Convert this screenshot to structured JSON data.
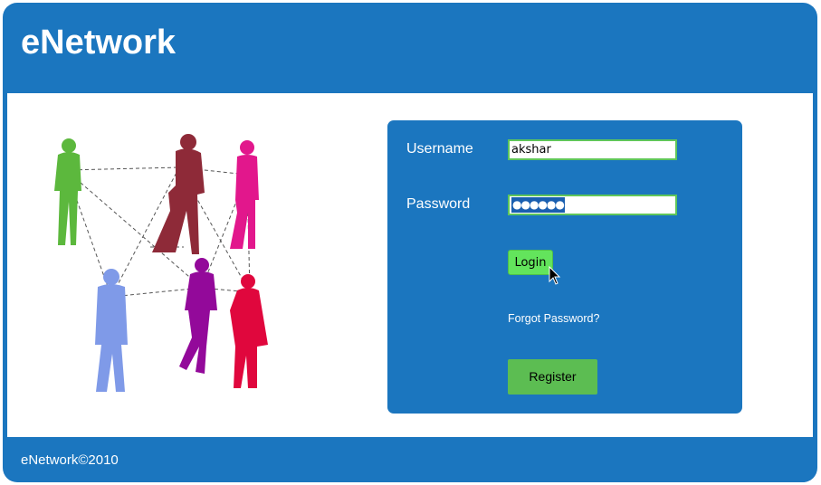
{
  "header": {
    "title": "eNetwork"
  },
  "login": {
    "username_label": "Username",
    "username_value": "akshar",
    "password_label": "Password",
    "password_mask": "●●●●●●",
    "login_label": "Login",
    "forgot_label": "Forgot Password?",
    "register_label": "Register"
  },
  "footer": {
    "text": "eNetwork©2010"
  },
  "illustration": {
    "people_colors": [
      "#5cb83d",
      "#8e2a38",
      "#e2178c",
      "#7f9ae8",
      "#93099a",
      "#e0073d"
    ]
  },
  "colors": {
    "brand_blue": "#1b76bf",
    "accent_green": "#5fc65a",
    "login_button": "#63e45c"
  }
}
